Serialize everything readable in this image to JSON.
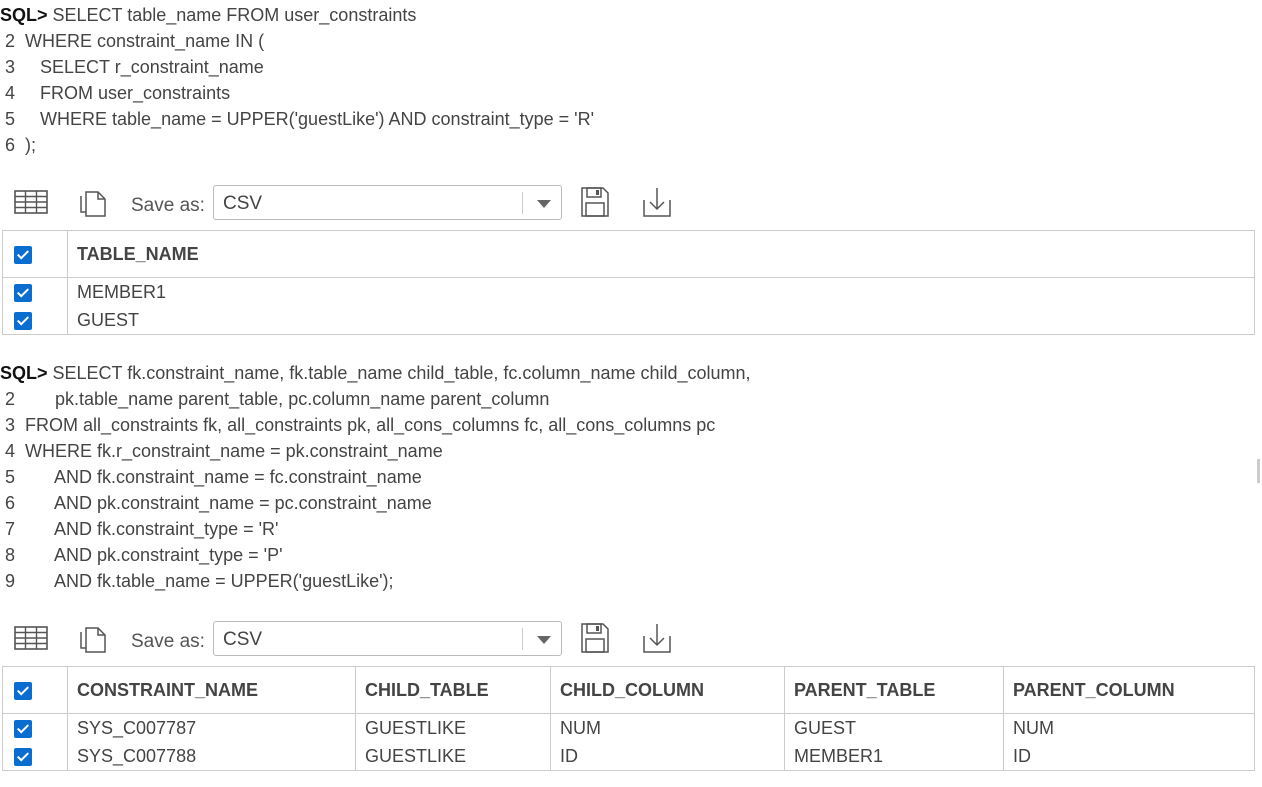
{
  "query1": {
    "prompt": "SQL>",
    "lines": [
      {
        "num": "",
        "text": " SELECT table_name FROM user_constraints"
      },
      {
        "num": " 2",
        "text": "  WHERE constraint_name IN ("
      },
      {
        "num": " 3",
        "text": "     SELECT r_constraint_name"
      },
      {
        "num": " 4",
        "text": "     FROM user_constraints"
      },
      {
        "num": " 5",
        "text": "     WHERE table_name = UPPER('guestLike') AND constraint_type = 'R'"
      },
      {
        "num": " 6",
        "text": "  );"
      }
    ]
  },
  "toolbar1": {
    "save_as_label": "Save as:",
    "format": "CSV"
  },
  "result1": {
    "columns": [
      "TABLE_NAME"
    ],
    "rows": [
      [
        "MEMBER1"
      ],
      [
        "GUEST"
      ]
    ]
  },
  "query2": {
    "prompt": "SQL>",
    "lines": [
      {
        "num": "",
        "text": " SELECT fk.constraint_name, fk.table_name child_table, fc.column_name child_column,"
      },
      {
        "num": " 2",
        "text": "        pk.table_name parent_table, pc.column_name parent_column"
      },
      {
        "num": " 3",
        "text": "  FROM all_constraints fk, all_constraints pk, all_cons_columns fc, all_cons_columns pc"
      },
      {
        "num": " 4",
        "text": "  WHERE fk.r_constraint_name = pk.constraint_name"
      },
      {
        "num": " 5",
        "text": "        AND fk.constraint_name = fc.constraint_name"
      },
      {
        "num": " 6",
        "text": "        AND pk.constraint_name = pc.constraint_name"
      },
      {
        "num": " 7",
        "text": "        AND fk.constraint_type = 'R'"
      },
      {
        "num": " 8",
        "text": "        AND pk.constraint_type = 'P'"
      },
      {
        "num": " 9",
        "text": "        AND fk.table_name = UPPER('guestLike');"
      }
    ]
  },
  "toolbar2": {
    "save_as_label": "Save as:",
    "format": "CSV"
  },
  "result2": {
    "columns": [
      "CONSTRAINT_NAME",
      "CHILD_TABLE",
      "CHILD_COLUMN",
      "PARENT_TABLE",
      "PARENT_COLUMN"
    ],
    "rows": [
      [
        "SYS_C007787",
        "GUESTLIKE",
        "NUM",
        "GUEST",
        "NUM"
      ],
      [
        "SYS_C007788",
        "GUESTLIKE",
        "ID",
        "MEMBER1",
        "ID"
      ]
    ]
  },
  "icons": {
    "grid_view": "table-grid-icon",
    "copy": "copy-icon",
    "save": "floppy-save-icon",
    "download": "download-icon",
    "checkbox": "checkbox-checked-icon"
  },
  "colors": {
    "checkbox": "#0a6ed1",
    "border": "#cccccc",
    "text": "#444444"
  }
}
